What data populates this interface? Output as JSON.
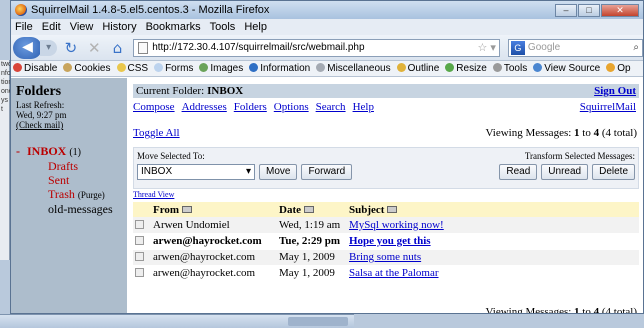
{
  "window": {
    "title": "SquirrelMail 1.4.8-5.el5.centos.3 - Mozilla Firefox"
  },
  "menu": [
    "File",
    "Edit",
    "View",
    "History",
    "Bookmarks",
    "Tools",
    "Help"
  ],
  "nav": {
    "url": "http://172.30.4.107/squirrelmail/src/webmail.php",
    "search_engine": "G",
    "search_placeholder": "Google"
  },
  "devbar": [
    "Disable",
    "Cookies",
    "CSS",
    "Forms",
    "Images",
    "Information",
    "Miscellaneous",
    "Outline",
    "Resize",
    "Tools",
    "View Source",
    "Op"
  ],
  "folders": {
    "heading": "Folders",
    "last_refresh_label": "Last Refresh:",
    "last_refresh_value": "Wed, 9:27 pm",
    "check_mail": "(Check mail)",
    "inbox_marker": "-",
    "inbox": "INBOX",
    "inbox_count": "(1)",
    "drafts": "Drafts",
    "sent": "Sent",
    "trash": "Trash",
    "purge": "(Purge)",
    "old": "old-messages"
  },
  "main": {
    "current_folder_label": "Current Folder:",
    "current_folder": "INBOX",
    "sign_out": "Sign Out",
    "links": [
      "Compose",
      "Addresses",
      "Folders",
      "Options",
      "Search",
      "Help"
    ],
    "squirrelmail": "SquirrelMail",
    "toggle_all": "Toggle All",
    "viewing_prefix": "Viewing Messages:",
    "viewing_from": "1",
    "viewing_to_word": "to",
    "viewing_to": "4",
    "viewing_total": "(4 total)",
    "move_selected_to": "Move Selected To:",
    "transform_label": "Transform Selected Messages:",
    "move_select_value": "INBOX",
    "move_btn": "Move",
    "forward_btn": "Forward",
    "read_btn": "Read",
    "unread_btn": "Unread",
    "delete_btn": "Delete",
    "thread_view": "Thread View",
    "columns": [
      "From",
      "Date",
      "Subject"
    ],
    "rows": [
      {
        "from": "Arwen Undomiel",
        "date": "Wed, 1:19 am",
        "subject": "MySql working now!"
      },
      {
        "from": "arwen@hayrocket.com",
        "date": "Tue, 2:29 pm",
        "subject": "Hope you get this"
      },
      {
        "from": "arwen@hayrocket.com",
        "date": "May 1, 2009",
        "subject": "Bring some nuts"
      },
      {
        "from": "arwen@hayrocket.com",
        "date": "May 1, 2009",
        "subject": "Salsa at the Palomar"
      }
    ]
  },
  "bg_window_text": [
    "two",
    "nfo",
    "tion",
    "one",
    "ys t"
  ]
}
